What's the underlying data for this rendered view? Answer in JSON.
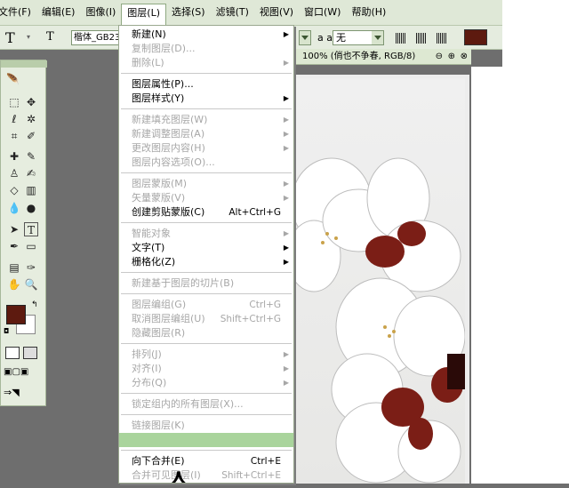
{
  "menubar": {
    "items": [
      "文件(F)",
      "编辑(E)",
      "图像(I)",
      "图层(L)",
      "选择(S)",
      "滤镜(T)",
      "视图(V)",
      "窗口(W)",
      "帮助(H)"
    ],
    "active": "图层(L)"
  },
  "options_bar": {
    "tool_icon": "T",
    "tool_icon2": "T",
    "font_family": "楷体_GB23",
    "aa_label": "a a",
    "aa_value": "无",
    "color_hex": "#5d1a0f"
  },
  "doc_window": {
    "title": "100% (俏也不争春, RGB/8)"
  },
  "layer_menu": [
    {
      "label": "新建(N)",
      "shortcut": "",
      "submenu": true,
      "disabled": false
    },
    {
      "label": "复制图层(D)...",
      "shortcut": "",
      "submenu": false,
      "disabled": true
    },
    {
      "label": "删除(L)",
      "shortcut": "",
      "submenu": true,
      "disabled": true
    },
    {
      "sep": true
    },
    {
      "label": "图层属性(P)...",
      "shortcut": "",
      "submenu": false,
      "disabled": false
    },
    {
      "label": "图层样式(Y)",
      "shortcut": "",
      "submenu": true,
      "disabled": false
    },
    {
      "sep": true
    },
    {
      "label": "新建填充图层(W)",
      "shortcut": "",
      "submenu": true,
      "disabled": true
    },
    {
      "label": "新建调整图层(A)",
      "shortcut": "",
      "submenu": true,
      "disabled": true
    },
    {
      "label": "更改图层内容(H)",
      "shortcut": "",
      "submenu": true,
      "disabled": true
    },
    {
      "label": "图层内容选项(O)...",
      "shortcut": "",
      "submenu": false,
      "disabled": true
    },
    {
      "sep": true
    },
    {
      "label": "图层蒙版(M)",
      "shortcut": "",
      "submenu": true,
      "disabled": true
    },
    {
      "label": "矢量蒙版(V)",
      "shortcut": "",
      "submenu": true,
      "disabled": true
    },
    {
      "label": "创建剪贴蒙版(C)",
      "shortcut": "Alt+Ctrl+G",
      "submenu": false,
      "disabled": false
    },
    {
      "sep": true
    },
    {
      "label": "智能对象",
      "shortcut": "",
      "submenu": true,
      "disabled": true
    },
    {
      "label": "文字(T)",
      "shortcut": "",
      "submenu": true,
      "disabled": false
    },
    {
      "label": "栅格化(Z)",
      "shortcut": "",
      "submenu": true,
      "disabled": false
    },
    {
      "sep": true
    },
    {
      "label": "新建基于图层的切片(B)",
      "shortcut": "",
      "submenu": false,
      "disabled": true
    },
    {
      "sep": true
    },
    {
      "label": "图层编组(G)",
      "shortcut": "Ctrl+G",
      "submenu": false,
      "disabled": true
    },
    {
      "label": "取消图层编组(U)",
      "shortcut": "Shift+Ctrl+G",
      "submenu": false,
      "disabled": true
    },
    {
      "label": "隐藏图层(R)",
      "shortcut": "",
      "submenu": false,
      "disabled": true
    },
    {
      "sep": true
    },
    {
      "label": "排列(J)",
      "shortcut": "",
      "submenu": true,
      "disabled": true
    },
    {
      "label": "对齐(I)",
      "shortcut": "",
      "submenu": true,
      "disabled": true
    },
    {
      "label": "分布(Q)",
      "shortcut": "",
      "submenu": true,
      "disabled": true
    },
    {
      "sep": true
    },
    {
      "label": "锁定组内的所有图层(X)...",
      "shortcut": "",
      "submenu": false,
      "disabled": true
    },
    {
      "sep": true
    },
    {
      "label": "链接图层(K)",
      "shortcut": "",
      "submenu": false,
      "disabled": true
    },
    {
      "label": "",
      "shortcut": "",
      "submenu": false,
      "disabled": true,
      "highlight": true
    },
    {
      "sep": true
    },
    {
      "label": "向下合并(E)",
      "shortcut": "Ctrl+E",
      "submenu": false,
      "disabled": false
    },
    {
      "label": "合并可见图层(I)",
      "shortcut": "Shift+Ctrl+E",
      "submenu": false,
      "disabled": true
    }
  ],
  "colors": {
    "foreground": "#5d1a0f",
    "background": "#ffffff",
    "highlight": "#a9d49c"
  }
}
